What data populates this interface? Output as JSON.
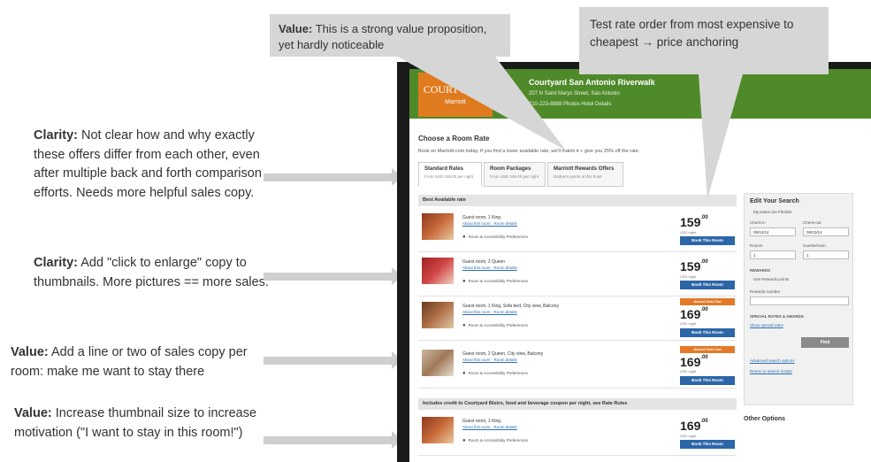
{
  "annotations": {
    "callout_top_left": {
      "label": "Value:",
      "text": "This is a strong value proposition, yet hardly noticeable"
    },
    "callout_top_right": {
      "text": "Test rate order from most expensive to cheapest → price anchoring"
    },
    "note1": {
      "label": "Clarity:",
      "text": "Not clear how and why exactly these offers differ from each other, even after multiple back and forth comparison efforts. Needs more helpful sales copy."
    },
    "note2": {
      "label": "Clarity:",
      "text": "Add \"click to enlarge\" copy to thumbnails. More pictures == more sales."
    },
    "note3": {
      "label": "Value:",
      "text": "Add a line or two of sales copy per room: make me want to stay there"
    },
    "note4": {
      "label": "Value:",
      "text": "Increase thumbnail size to increase motivation (\"I want to stay in this room!\")"
    }
  },
  "site": {
    "logo_text": "COURTYARD",
    "logo_sub": "Marriott",
    "hotel_name": "Courtyard San Antonio Riverwalk",
    "hotel_address": "207 N Saint Marys Street, San Antonio",
    "hotel_phone": "210-223-8888   Photos   Hotel Details",
    "heading": "Choose a Room Rate",
    "intro": "Book on Marriott.com today. If you find a lower available rate, we'll match it + give you 25% off the rate.",
    "tabs": [
      {
        "label": "Standard Rates",
        "sub": "From USD 159.00 per night"
      },
      {
        "label": "Room Packages",
        "sub": "From USD 169.00 per night"
      },
      {
        "label": "Marriott Rewards Offers",
        "sub": "Redeem points at this hotel"
      }
    ],
    "section_best": "Best Available rate",
    "section_credit": "Includes credit to Courtyard Bistro, food and beverage coupon per night, see Rate Rules",
    "rooms": [
      {
        "name": "Guest room, 1 King",
        "links": "About this room  ·  Room details",
        "pref": "Room & Accessibility Preferences",
        "price": "159",
        "cents": ".00",
        "per": "USD night",
        "book": "Book This Room",
        "badge": ""
      },
      {
        "name": "Guest room, 2 Queen",
        "links": "About this room  ·  Room details",
        "pref": "Room & Accessibility Preferences",
        "price": "159",
        "cents": ".00",
        "per": "USD night",
        "book": "Book This Room",
        "badge": ""
      },
      {
        "name": "Guest room, 1 King, Sofa bed, City view, Balcony",
        "links": "About this room  ·  Room details",
        "pref": "Room & Accessibility Preferences",
        "price": "169",
        "cents": ".00",
        "per": "USD night",
        "book": "Book This Room",
        "badge": "Almost Sold Out"
      },
      {
        "name": "Guest room, 2 Queen, City view, Balcony",
        "links": "About this room  ·  Room details",
        "pref": "Room & Accessibility Preferences",
        "price": "169",
        "cents": ".00",
        "per": "USD night",
        "book": "Book This Room",
        "badge": "Almost Sold Out"
      },
      {
        "name": "Guest room, 1 King",
        "links": "About this room  ·  Room details",
        "pref": "Room & Accessibility Preferences",
        "price": "169",
        "cents": ".00",
        "per": "USD night",
        "book": "Book This Room",
        "badge": ""
      }
    ],
    "sidebar": {
      "title": "Edit Your Search",
      "flexible": "My Dates are Flexible",
      "checkin_label": "Check-in",
      "checkout_label": "Check-out",
      "checkin": "09/12/14",
      "checkout": "09/13/14",
      "rooms_label": "Rooms",
      "guests_label": "Guests/room",
      "rooms": "1",
      "guests": "1",
      "rewards": "REWARDS",
      "rewards_sub": "Use Rewards points",
      "rewards_num_label": "Rewards number",
      "special": "SPECIAL RATES & AWARDS",
      "special_link": "Show special rates",
      "find": "Find",
      "link1": "Advanced search options",
      "link2": "Return to search results"
    },
    "other_options": "Other Options"
  },
  "colors": {
    "header_green": "#4f8a2a",
    "logo_orange": "#e07a1e",
    "book_blue": "#2c66a8",
    "badge_orange": "#e4792a",
    "callout_gray": "#d6d6d6"
  }
}
